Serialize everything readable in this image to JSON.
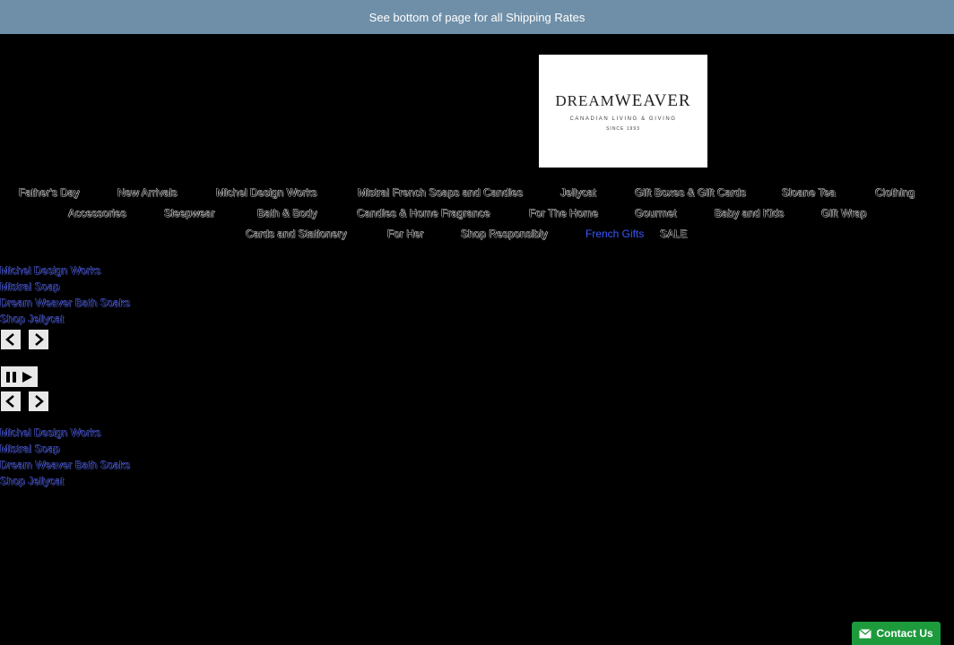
{
  "announcement": {
    "text": "See bottom of page for all Shipping Rates"
  },
  "logo": {
    "word1": "DREAM",
    "word2": "WEAVER",
    "tagline": "CANADIAN LIVING & GIVING",
    "since": "SINCE 1993"
  },
  "nav": {
    "items": [
      "Father's Day",
      "New Arrivals",
      "Michel Design Works",
      "Mistral French Soaps and Candles",
      "Jellycat",
      "Gift Boxes & Gift Cards",
      "Sloane Tea",
      "Clothing",
      "Accessories",
      "Sleepwear",
      "Bath & Body",
      "Candles & Home Fragrance",
      "For The Home",
      "Gourmet",
      "Baby and Kids",
      "Gift Wrap",
      "Cards and Stationery",
      "For Her",
      "Shop Responsibly",
      "French Gifts",
      "SALE"
    ]
  },
  "slideshow1": {
    "links": [
      "Michel Design Works",
      "Mistral Soap",
      "Dream Weaver Bath Soaks",
      "Shop Jellycat"
    ]
  },
  "slideshow2": {
    "links": [
      "Michel Design Works",
      "Mistral Soap",
      "Dream Weaver Bath Soaks",
      "Shop Jellycat"
    ]
  },
  "contact": {
    "label": "Contact Us"
  },
  "colors": {
    "announcement_bg": "#6f8fa8",
    "link_blue": "#3b57ff",
    "contact_green": "#1d9a3c"
  }
}
